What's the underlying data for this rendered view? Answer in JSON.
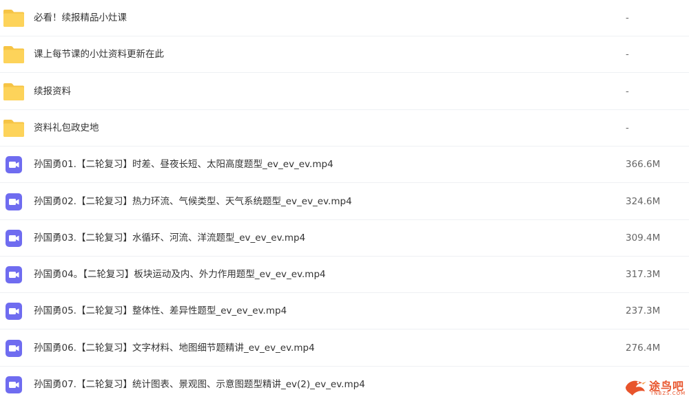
{
  "files": [
    {
      "type": "folder",
      "icon": "folder-icon",
      "name": "必看！续报精品小灶课",
      "size": "-"
    },
    {
      "type": "folder",
      "icon": "folder-icon",
      "name": "课上每节课的小灶资料更新在此",
      "size": "-"
    },
    {
      "type": "folder",
      "icon": "folder-icon",
      "name": "续报资料",
      "size": "-"
    },
    {
      "type": "folder",
      "icon": "folder-icon",
      "name": "资料礼包政史地",
      "size": "-"
    },
    {
      "type": "video",
      "icon": "video-file-icon",
      "name": "孙国勇01.【二轮复习】时差、昼夜长短、太阳高度题型_ev_ev_ev.mp4",
      "size": "366.6M"
    },
    {
      "type": "video",
      "icon": "video-file-icon",
      "name": "孙国勇02.【二轮复习】热力环流、气候类型、天气系统题型_ev_ev_ev.mp4",
      "size": "324.6M"
    },
    {
      "type": "video",
      "icon": "video-file-icon",
      "name": "孙国勇03.【二轮复习】水循环、河流、洋流题型_ev_ev_ev.mp4",
      "size": "309.4M"
    },
    {
      "type": "video",
      "icon": "video-file-icon",
      "name": "孙国勇04。【二轮复习】板块运动及内、外力作用题型_ev_ev_ev.mp4",
      "size": "317.3M"
    },
    {
      "type": "video",
      "icon": "video-file-icon",
      "name": "孙国勇05.【二轮复习】整体性、差异性题型_ev_ev_ev.mp4",
      "size": "237.3M"
    },
    {
      "type": "video",
      "icon": "video-file-icon",
      "name": "孙国勇06.【二轮复习】文字材料、地图细节题精讲_ev_ev_ev.mp4",
      "size": "276.4M"
    },
    {
      "type": "video",
      "icon": "video-file-icon",
      "name": "孙国勇07.【二轮复习】统计图表、景观图、示意图题型精讲_ev(2)_ev_ev.mp4",
      "size": ""
    }
  ],
  "watermark": {
    "text": "途鸟吧",
    "subtext": "TNBZS.COM"
  },
  "colors": {
    "folder": "#fdd35a",
    "video": "#6f6cf0",
    "divider": "#eef0f3",
    "watermark": "#e8542b"
  }
}
